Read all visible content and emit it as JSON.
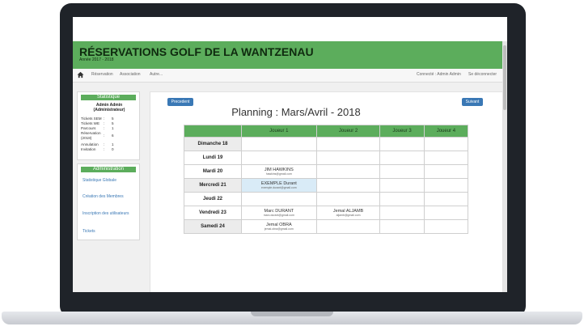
{
  "header": {
    "title": "RÉSERVATIONS GOLF DE LA WANTZENAU",
    "subtitle": "Année 2017 - 2018"
  },
  "nav": {
    "items": [
      "Réservation",
      "Association",
      "Autre..."
    ],
    "right": [
      "Connecté : Admin Admin",
      "Se déconnecter"
    ]
  },
  "stats": {
    "title": "Statistique",
    "user": "Admin Admin",
    "role": "(Administrateur)",
    "rows": [
      {
        "label": "Tickets SEM",
        "value": "5"
      },
      {
        "label": "Tickets WE",
        "value": "5"
      },
      {
        "label": "Parcours",
        "value": "1"
      },
      {
        "label": "Réservation (2018)",
        "value": "6"
      },
      {
        "label": "Annulation",
        "value": "1"
      },
      {
        "label": "Invitation",
        "value": "0"
      }
    ]
  },
  "admin": {
    "title": "Administration",
    "links": [
      "Statistique Globale",
      "Création des Membres",
      "Inscription des utilisateurs",
      "Tickets"
    ]
  },
  "planning": {
    "title": "Planning : Mars/Avril - 2018",
    "prev": "Precedent",
    "next": "Suivant",
    "columns": [
      "",
      "Joueur 1",
      "Joueur 2",
      "Joueur 3",
      "Joueur 4"
    ],
    "rows": [
      {
        "day": "Dimanche 18",
        "players": [
          null,
          null,
          null,
          null
        ]
      },
      {
        "day": "Lundi 19",
        "players": [
          null,
          null,
          null,
          null
        ]
      },
      {
        "day": "Mardi 20",
        "players": [
          {
            "name": "JIM HAWKINS",
            "email": "hawkins@gmail.com"
          },
          null,
          null,
          null
        ]
      },
      {
        "day": "Mercredi 21",
        "players": [
          {
            "name": "EXEMPLE Durant",
            "email": "exemple.durant@gmail.com"
          },
          null,
          null,
          null
        ]
      },
      {
        "day": "Jeudi 22",
        "players": [
          null,
          null,
          null,
          null
        ]
      },
      {
        "day": "Vendredi 23",
        "players": [
          {
            "name": "Marc DURANT",
            "email": "marc.durant@gmail.com"
          },
          {
            "name": "Jemal ALJAMB",
            "email": "aljamb@gmail.com"
          },
          null,
          null
        ]
      },
      {
        "day": "Samedi 24",
        "players": [
          {
            "name": "Jemal OBRA",
            "email": "jemal.obra@gmail.com"
          },
          null,
          null,
          null
        ]
      }
    ]
  },
  "colors": {
    "accent": "#5cad5c",
    "button": "#3a78b5",
    "highlight": "#d9ebf7"
  }
}
